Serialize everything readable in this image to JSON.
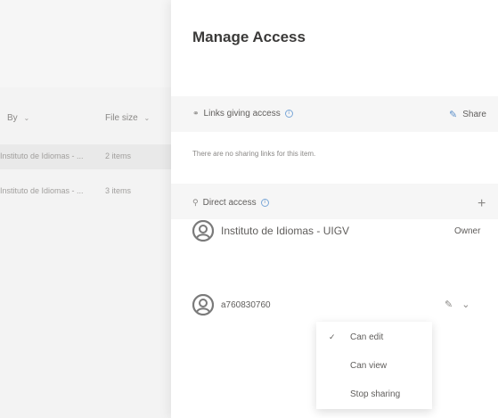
{
  "file_list": {
    "columns": [
      {
        "label": "By",
        "chevron": "chevron-down-icon"
      },
      {
        "label": "File size",
        "chevron": "chevron-down-icon"
      }
    ],
    "rows": [
      {
        "modified_by": "Instituto de Idiomas - ...",
        "file_size": "2 items",
        "selected": true
      },
      {
        "modified_by": "Instituto de Idiomas - ...",
        "file_size": "3 items",
        "selected": false
      }
    ]
  },
  "panel": {
    "title": "Manage Access",
    "links_section": {
      "label": "Links giving access",
      "icon": "link-icon",
      "share_label": "Share",
      "empty_text": "There are no sharing links for this item."
    },
    "direct_access": {
      "label": "Direct access",
      "icon": "people-icon",
      "add_label": "+"
    },
    "people": [
      {
        "name": "Instituto de Idiomas - UIGV",
        "role": "Owner"
      },
      {
        "name": "a760830760",
        "role": ""
      }
    ],
    "permission_menu": {
      "items": [
        {
          "label": "Can edit",
          "checked": true
        },
        {
          "label": "Can view",
          "checked": false
        },
        {
          "label": "Stop sharing",
          "checked": false
        }
      ]
    }
  },
  "colors": {
    "accent": "#5b8fc9",
    "panel_bg": "#ffffff",
    "band_bg": "#f6f6f6"
  }
}
